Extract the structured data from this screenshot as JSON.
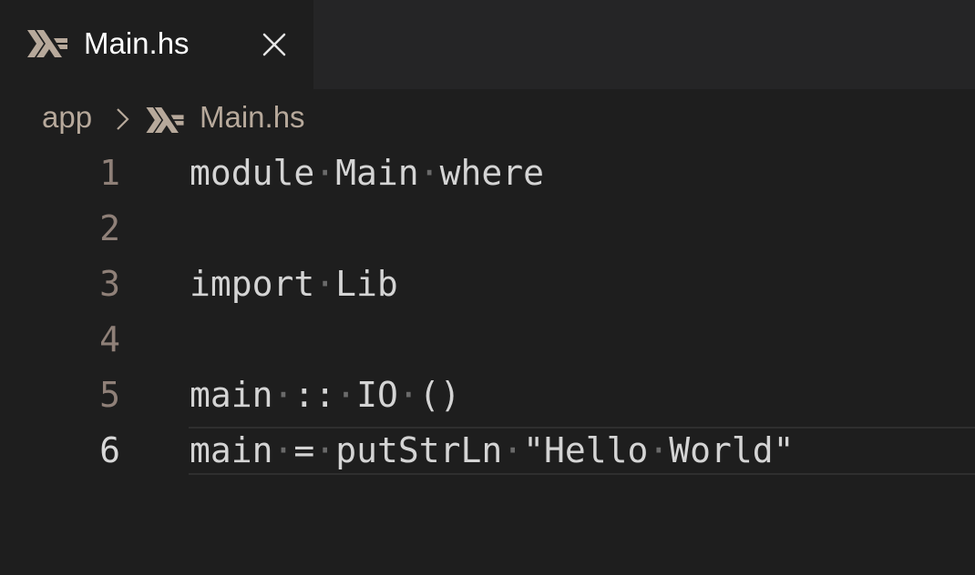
{
  "tab": {
    "title": "Main.hs",
    "icon": "haskell-icon",
    "close_icon": "close-icon"
  },
  "breadcrumb": {
    "folder": "app",
    "separator_icon": "chevron-right-icon",
    "file_icon": "haskell-icon",
    "file": "Main.hs"
  },
  "editor": {
    "current_line": 6,
    "whitespace_glyph": "·",
    "lines": [
      {
        "number": "1",
        "tokens": [
          "module",
          "Main",
          "where"
        ]
      },
      {
        "number": "2",
        "tokens": []
      },
      {
        "number": "3",
        "tokens": [
          "import",
          "Lib"
        ]
      },
      {
        "number": "4",
        "tokens": []
      },
      {
        "number": "5",
        "tokens": [
          "main",
          "::",
          "IO",
          "()"
        ]
      },
      {
        "number": "6",
        "tokens": [
          "main",
          "=",
          "putStrLn",
          "\"Hello",
          "World\""
        ]
      }
    ]
  },
  "colors": {
    "editor_background": "#1e1e1e",
    "tabbar_background": "#252526",
    "tab_title": "#ffffff",
    "breadcrumb_text": "#b7a99b",
    "line_number": "#8f8078",
    "current_line_number": "#d8d8d8",
    "code_text": "#d4d4d4",
    "whitespace_dot": "#6a6a6a",
    "icon_tan": "#b7a99b"
  }
}
